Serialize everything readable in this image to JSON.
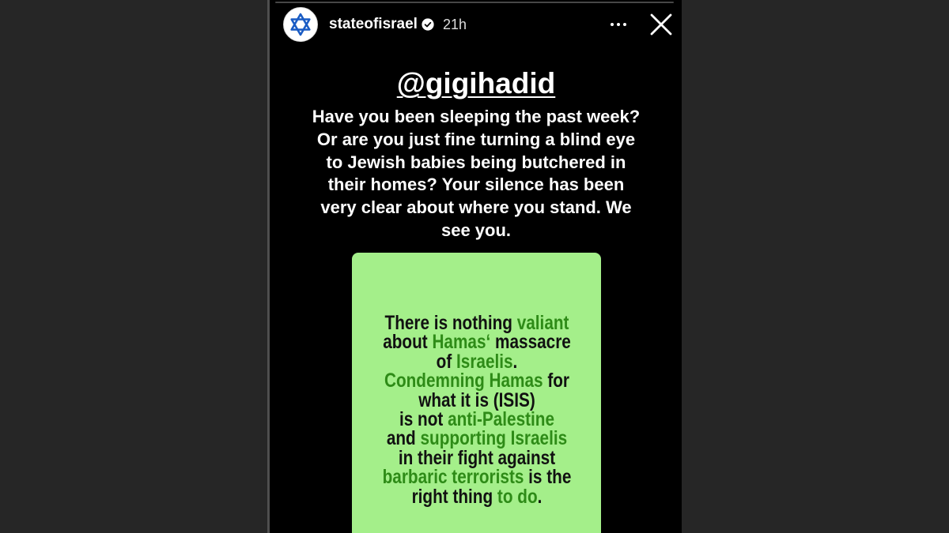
{
  "story": {
    "avatar_icon": "star-of-david-icon",
    "username": "stateofisrael",
    "verified_icon": "verified-badge-icon",
    "time_ago": "21h",
    "more_icon": "more-horizontal-icon",
    "close_icon": "close-icon",
    "mention": "@gigihadid",
    "caption_lines": [
      "Have you been sleeping the past week?",
      "Or are you just fine turning a blind eye",
      "to Jewish babies being butchered in",
      "their homes? Your silence has been",
      "very clear about where you stand. We",
      "see you."
    ],
    "card": {
      "background_color": "#a4ef8a",
      "text_color": "#111111",
      "highlight_color": "#2e8b17",
      "lines": [
        [
          {
            "text": "There is nothing ",
            "highlight": false
          },
          {
            "text": "valiant",
            "highlight": true
          }
        ],
        [
          {
            "text": "about ",
            "highlight": false
          },
          {
            "text": "Hamas‘",
            "highlight": true
          },
          {
            "text": " massacre",
            "highlight": false
          }
        ],
        [
          {
            "text": "of ",
            "highlight": false
          },
          {
            "text": "Israelis",
            "highlight": true
          },
          {
            "text": ".",
            "highlight": false
          }
        ],
        [
          {
            "text": "Condemning Hamas",
            "highlight": true
          },
          {
            "text": " for",
            "highlight": false
          }
        ],
        [
          {
            "text": "what it is (ISIS)",
            "highlight": false
          }
        ],
        [
          {
            "text": "is not ",
            "highlight": false
          },
          {
            "text": "anti-Palestine",
            "highlight": true
          }
        ],
        [
          {
            "text": "and ",
            "highlight": false
          },
          {
            "text": "supporting Israelis",
            "highlight": true
          }
        ],
        [
          {
            "text": "in their fight against",
            "highlight": false
          }
        ],
        [
          {
            "text": "barbaric terrorists",
            "highlight": true
          },
          {
            "text": " is the",
            "highlight": false
          }
        ],
        [
          {
            "text": "right thing ",
            "highlight": false
          },
          {
            "text": "to do",
            "highlight": true
          },
          {
            "text": ".",
            "highlight": false
          }
        ]
      ]
    }
  },
  "colors": {
    "page_background": "#262626",
    "story_background": "#000000",
    "avatar_star": "#1a5cc4"
  }
}
